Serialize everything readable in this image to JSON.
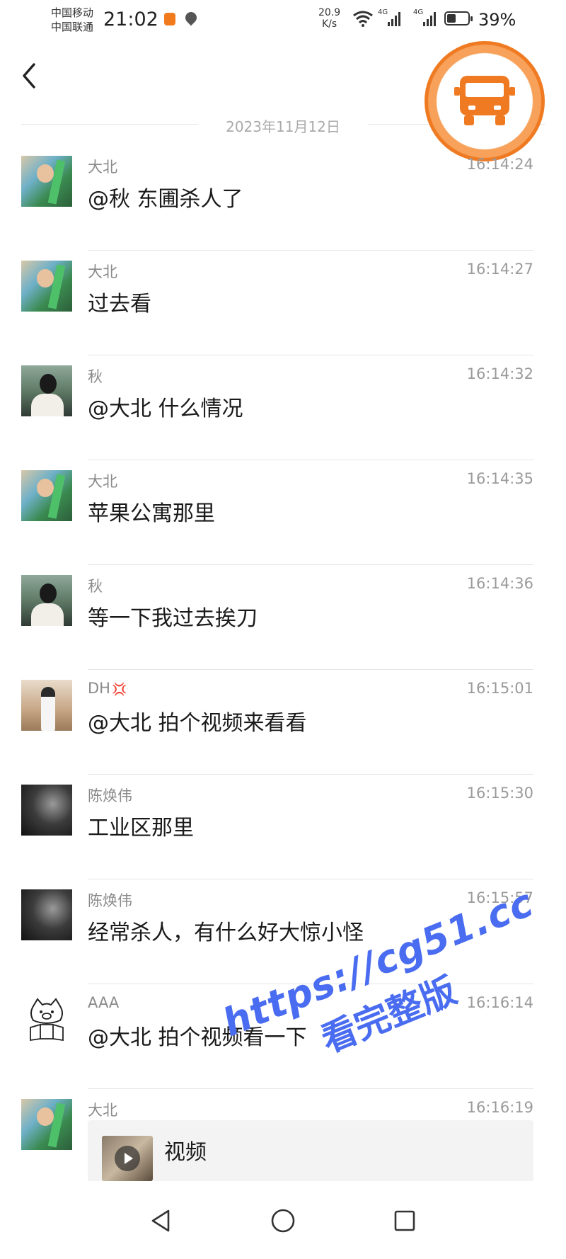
{
  "status_bar": {
    "carrier_1": "中国移动",
    "carrier_2": "中国联通",
    "time": "21:02",
    "net_speed_value": "20.9",
    "net_speed_unit": "K/s",
    "signal_tag": "4G",
    "battery_percent": "39%",
    "battery_level": 0.39
  },
  "header": {
    "date_separator": "2023年11月12日"
  },
  "messages": [
    {
      "name": "大北",
      "time": "16:14:24",
      "text": "@秋 东圃杀人了"
    },
    {
      "name": "大北",
      "time": "16:14:27",
      "text": "过去看"
    },
    {
      "name": "秋",
      "time": "16:14:32",
      "text": "@大北 什么情况"
    },
    {
      "name": "大北",
      "time": "16:14:35",
      "text": "苹果公寓那里"
    },
    {
      "name": "秋",
      "time": "16:14:36",
      "text": "等一下我过去挨刀"
    },
    {
      "name": "DH",
      "name_emoji": "💢",
      "time": "16:15:01",
      "text": "@大北 拍个视频来看看"
    },
    {
      "name": "陈焕伟",
      "time": "16:15:30",
      "text": "工业区那里"
    },
    {
      "name": "陈焕伟",
      "time": "16:15:57",
      "text": "经常杀人，有什么好大惊小怪"
    },
    {
      "name": "AAA",
      "time": "16:16:14",
      "text": "@大北 拍个视频看一下"
    },
    {
      "name": "大北",
      "time": "16:16:19",
      "video_title": "视频"
    }
  ],
  "watermark": {
    "line_1": "https://cg51.cc",
    "line_2": "看完整版"
  },
  "colors": {
    "accent_orange": "#ef7a22",
    "watermark_blue": "#4a6cf0",
    "divider": "#e6e6e6",
    "meta_gray": "#9a9a9a"
  },
  "icons": {
    "back": "chevron-left-icon",
    "float_ball": "van-icon",
    "nav_back": "triangle-back-icon",
    "nav_home": "circle-home-icon",
    "nav_recent": "square-recent-icon"
  }
}
